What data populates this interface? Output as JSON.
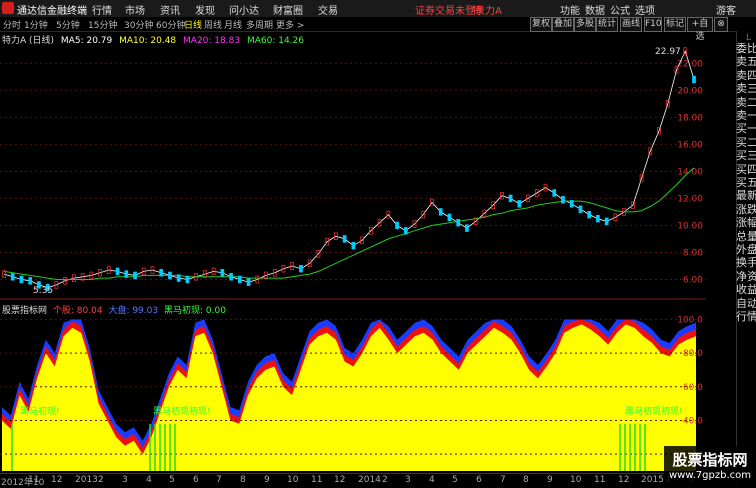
{
  "app": {
    "title": "通达信金融终端",
    "menu": [
      "行情",
      "市场",
      "资讯",
      "发现",
      "问小达",
      "财富圈",
      "交易"
    ],
    "alert": "证券交易未登录",
    "stock_name": "特 力A",
    "right_menu": [
      "功能",
      "数据",
      "公式",
      "选项"
    ],
    "user": "游客"
  },
  "toolbar": {
    "periods": [
      "分时",
      "1分钟",
      "5分钟",
      "15分钟",
      "30分钟",
      "60分钟",
      "日线",
      "周线",
      "月线",
      "多周期",
      "更多 >"
    ],
    "active": "日线",
    "tools": [
      "复权",
      "叠加",
      "多股",
      "统计",
      "画线",
      "F10",
      "标记",
      "+自选",
      "⊗"
    ]
  },
  "main_info": {
    "name": "特力A (日线)",
    "ma5": "MA5: 20.79",
    "ma10": "MA10: 20.48",
    "ma20": "MA20: 18.83",
    "ma60": "MA60: 14.26",
    "high_label": "22.97",
    "low_label": "5.35"
  },
  "ind_info": {
    "name": "股票指标网",
    "a": "个股: 80.04",
    "b": "大盘: 99.03",
    "c": "黑马初现: 0.00",
    "tags": [
      "黑马初现!",
      "黑马初现初现!",
      "黑马初现初现!"
    ]
  },
  "right_panel": [
    "委比",
    "卖五",
    "卖四",
    "卖三",
    "卖二",
    "卖一",
    "买一",
    "买二",
    "买三",
    "买四",
    "买五",
    "最新",
    "涨跌",
    "涨幅",
    "总量",
    "外盘",
    "换手",
    "净资",
    "收益",
    "自动",
    "行情"
  ],
  "time_axis": [
    "2012年10",
    "11",
    "12",
    "2013",
    "2",
    "3",
    "4",
    "5",
    "6",
    "7",
    "8",
    "9",
    "10",
    "11",
    "12",
    "2014",
    "2",
    "3",
    "4",
    "5",
    "6",
    "7",
    "8",
    "9",
    "10",
    "11",
    "12",
    "2015",
    "2",
    "3"
  ],
  "watermark": {
    "cn": "股票指标网",
    "url": "www.7gpzb.com"
  },
  "chart_data": [
    {
      "type": "line",
      "title": "特力A (日线)",
      "yticks": [
        6.0,
        8.0,
        10.0,
        12.0,
        14.0,
        16.0,
        18.0,
        20.0,
        22.0
      ],
      "ylim": [
        5.0,
        23.5
      ],
      "annotations": [
        "22.97",
        "5.35"
      ],
      "series": [
        {
          "name": "price",
          "color": "#ffffff",
          "values": [
            6.4,
            6.2,
            6.0,
            5.9,
            5.6,
            5.4,
            5.6,
            5.9,
            6.1,
            6.2,
            6.3,
            6.5,
            6.7,
            6.6,
            6.4,
            6.3,
            6.6,
            6.7,
            6.5,
            6.3,
            6.1,
            6.0,
            6.2,
            6.4,
            6.6,
            6.5,
            6.2,
            6.0,
            5.8,
            6.0,
            6.3,
            6.5,
            6.8,
            7.0,
            6.8,
            7.2,
            7.9,
            8.8,
            9.2,
            9.0,
            8.5,
            8.9,
            9.6,
            10.2,
            10.8,
            10.0,
            9.6,
            10.1,
            10.8,
            11.7,
            11.0,
            10.6,
            10.2,
            9.8,
            10.3,
            10.9,
            11.5,
            12.2,
            12.0,
            11.6,
            12.0,
            12.4,
            12.8,
            12.4,
            11.9,
            11.6,
            11.2,
            10.8,
            10.5,
            10.3,
            10.6,
            11.0,
            11.5,
            13.5,
            15.5,
            17.0,
            19.0,
            21.5,
            22.9,
            20.8
          ]
        },
        {
          "name": "MA60",
          "color": "#22cc22",
          "values": [
            6.6,
            6.5,
            6.4,
            6.3,
            6.2,
            6.1,
            6.0,
            6.0,
            6.0,
            6.0,
            6.0,
            6.1,
            6.1,
            6.2,
            6.2,
            6.2,
            6.3,
            6.3,
            6.3,
            6.3,
            6.3,
            6.2,
            6.2,
            6.2,
            6.2,
            6.2,
            6.2,
            6.2,
            6.1,
            6.1,
            6.1,
            6.1,
            6.1,
            6.2,
            6.3,
            6.4,
            6.6,
            6.9,
            7.2,
            7.5,
            7.8,
            8.1,
            8.4,
            8.7,
            9.0,
            9.2,
            9.4,
            9.6,
            9.8,
            10.0,
            10.1,
            10.2,
            10.3,
            10.4,
            10.5,
            10.6,
            10.8,
            10.9,
            11.1,
            11.2,
            11.3,
            11.5,
            11.6,
            11.7,
            11.8,
            11.8,
            11.8,
            11.7,
            11.5,
            11.3,
            11.1,
            11.0,
            11.0,
            11.1,
            11.4,
            11.8,
            12.4,
            13.0,
            13.7,
            14.26
          ]
        }
      ]
    },
    {
      "type": "area",
      "title": "股票指标网",
      "yticks": [
        20.0,
        40.0,
        60.0,
        80.0,
        100.0
      ],
      "ylim": [
        10,
        102
      ],
      "values": [
        40,
        35,
        55,
        45,
        65,
        80,
        72,
        90,
        95,
        92,
        75,
        50,
        40,
        30,
        25,
        28,
        20,
        30,
        45,
        60,
        70,
        65,
        90,
        92,
        80,
        60,
        40,
        38,
        55,
        65,
        70,
        72,
        60,
        55,
        70,
        85,
        90,
        92,
        88,
        75,
        72,
        80,
        90,
        95,
        88,
        80,
        85,
        90,
        92,
        88,
        80,
        75,
        70,
        80,
        85,
        90,
        95,
        92,
        88,
        80,
        70,
        65,
        72,
        80,
        92,
        95,
        97,
        94,
        90,
        85,
        92,
        97,
        95,
        90,
        86,
        80,
        78,
        85,
        88,
        90
      ]
    }
  ]
}
